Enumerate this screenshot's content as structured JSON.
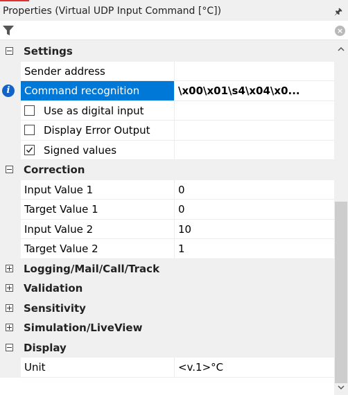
{
  "panel": {
    "title": "Properties (Virtual UDP Input Command [°C])",
    "pin_icon": "pin-icon",
    "filter_icon": "filter-icon",
    "clear_icon": "clear-filter-icon",
    "clear_glyph": "×"
  },
  "categories": {
    "settings": "Settings",
    "correction": "Correction",
    "logging": "Logging/Mail/Call/Track",
    "validation": "Validation",
    "sensitivity": "Sensitivity",
    "simulation": "Simulation/LiveView",
    "display": "Display"
  },
  "settings": {
    "sender_address": {
      "label": "Sender address",
      "value": ""
    },
    "command_recognition": {
      "label": "Command recognition",
      "value": "\\x00\\x01\\s4\\x04\\x0...",
      "selected": true
    },
    "use_as_digital_input": {
      "label": "Use as digital input",
      "checked": false
    },
    "display_error_output": {
      "label": "Display Error Output",
      "checked": false
    },
    "signed_values": {
      "label": "Signed values",
      "checked": true
    }
  },
  "correction": {
    "input_value_1": {
      "label": "Input Value 1",
      "value": "0"
    },
    "target_value_1": {
      "label": "Target Value 1",
      "value": "0"
    },
    "input_value_2": {
      "label": "Input Value 2",
      "value": "10"
    },
    "target_value_2": {
      "label": "Target Value 2",
      "value": "1"
    }
  },
  "display": {
    "unit": {
      "label": "Unit",
      "value": "<v.1>°C"
    }
  },
  "colors": {
    "selection": "#0078d7",
    "info_icon": "#1463c8",
    "background": "#f0f0f0"
  }
}
